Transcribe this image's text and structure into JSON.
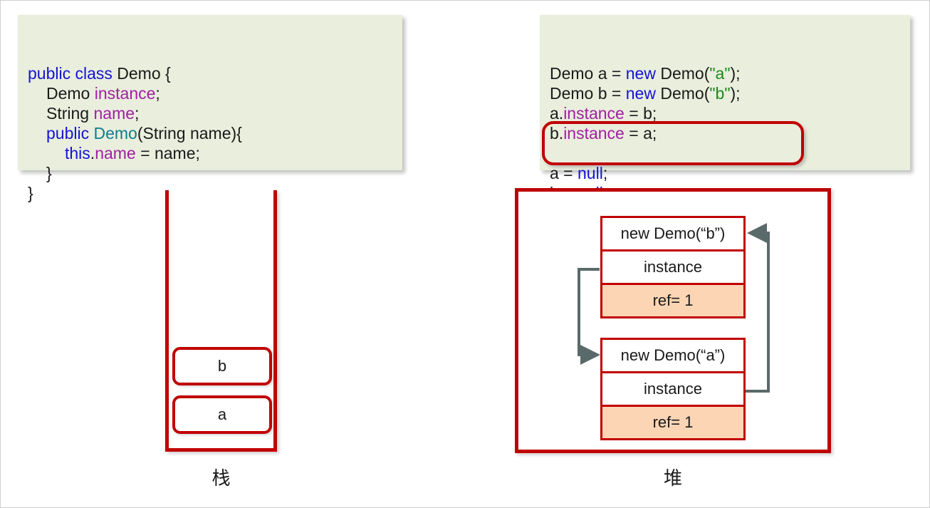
{
  "diagram": {
    "title_stack": "栈",
    "title_heap": "堆"
  },
  "code_left": {
    "lines": [
      [
        {
          "t": "public class",
          "c": "kw"
        },
        {
          "t": " Demo {",
          "c": "plain"
        }
      ],
      [
        {
          "t": "Demo ",
          "c": "plain"
        },
        {
          "t": "instance",
          "c": "fld"
        },
        {
          "t": ";",
          "c": "plain"
        }
      ],
      [
        {
          "t": "String ",
          "c": "plain"
        },
        {
          "t": "name",
          "c": "fld"
        },
        {
          "t": ";",
          "c": "plain"
        }
      ],
      [
        {
          "t": "public ",
          "c": "kw"
        },
        {
          "t": "Demo",
          "c": "type"
        },
        {
          "t": "(String name){",
          "c": "plain"
        }
      ],
      [
        {
          "t": "this",
          "c": "kw"
        },
        {
          "t": ".",
          "c": "plain"
        },
        {
          "t": "name",
          "c": "fld"
        },
        {
          "t": " = name;",
          "c": "plain"
        }
      ],
      [
        {
          "t": "}",
          "c": "plain"
        }
      ],
      [
        {
          "t": "}",
          "c": "plain"
        }
      ]
    ],
    "indents": [
      0,
      1,
      1,
      1,
      2,
      1,
      0
    ]
  },
  "code_right": {
    "lines": [
      [
        {
          "t": "Demo a = ",
          "c": "plain"
        },
        {
          "t": "new",
          "c": "kw"
        },
        {
          "t": " Demo(",
          "c": "plain"
        },
        {
          "t": "\"a\"",
          "c": "str"
        },
        {
          "t": ");",
          "c": "plain"
        }
      ],
      [
        {
          "t": "Demo b = ",
          "c": "plain"
        },
        {
          "t": "new",
          "c": "kw"
        },
        {
          "t": " Demo(",
          "c": "plain"
        },
        {
          "t": "\"b\"",
          "c": "str"
        },
        {
          "t": ");",
          "c": "plain"
        }
      ],
      [
        {
          "t": "a.",
          "c": "plain"
        },
        {
          "t": "instance",
          "c": "fld"
        },
        {
          "t": " = b;",
          "c": "plain"
        }
      ],
      [
        {
          "t": "b.",
          "c": "plain"
        },
        {
          "t": "instance",
          "c": "fld"
        },
        {
          "t": " = a;",
          "c": "plain"
        }
      ],
      [
        {
          "t": "",
          "c": "plain"
        }
      ],
      [
        {
          "t": "a = ",
          "c": "plain"
        },
        {
          "t": "null",
          "c": "kw"
        },
        {
          "t": ";",
          "c": "plain"
        }
      ],
      [
        {
          "t": "b = ",
          "c": "plain"
        },
        {
          "t": "null",
          "c": "kw"
        },
        {
          "t": ";",
          "c": "plain"
        }
      ]
    ],
    "indents": [
      0,
      0,
      0,
      0,
      0,
      0,
      0
    ],
    "highlight_lines": [
      "a = null;",
      "b = null;"
    ]
  },
  "stack": {
    "label": "栈",
    "cells": [
      {
        "name": "b"
      },
      {
        "name": "a"
      }
    ]
  },
  "heap": {
    "label": "堆",
    "objects": [
      {
        "id": "b",
        "header": "new Demo(“b”)",
        "field": "instance",
        "ref": "ref= 1"
      },
      {
        "id": "a",
        "header": "new Demo(“a”)",
        "field": "instance",
        "ref": "ref= 1"
      }
    ]
  },
  "colors": {
    "keyword": "#1414d2",
    "field": "#a020a0",
    "type": "#0d7e8c",
    "string": "#1a8a1a",
    "red": "#c00000",
    "code_bg": "#e9eedd",
    "ref_bg": "#fbd5b4",
    "arrow": "#5a6a6a"
  }
}
